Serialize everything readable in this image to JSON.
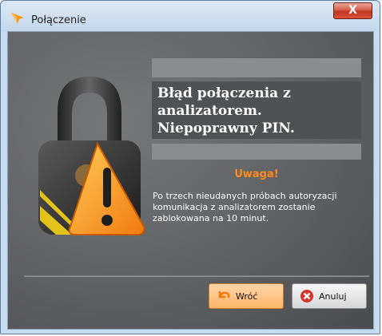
{
  "window": {
    "title": "Połączenie",
    "close_label": "X"
  },
  "error": {
    "message": "Błąd połączenia z analizatorem. Niepoprawny PIN."
  },
  "warning": {
    "title": "Uwaga!",
    "message": "Po trzech nieudanych próbach autoryzacji komunikacja z analizatorem zostanie zablokowana na 10 minut."
  },
  "buttons": {
    "back_label": "Wróć",
    "cancel_label": "Anuluj"
  },
  "icons": {
    "app": "app-logo-icon",
    "lock": "padlock-warning-icon",
    "back": "undo-arrow-icon",
    "cancel": "cancel-x-icon"
  },
  "colors": {
    "warning_accent": "#ff8a1c",
    "close_red": "#c0351f"
  }
}
